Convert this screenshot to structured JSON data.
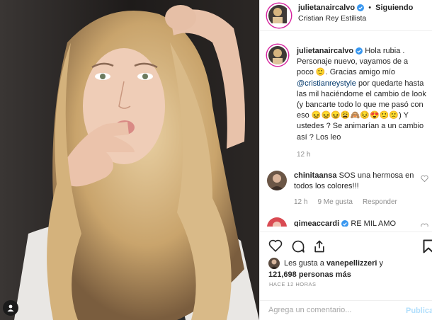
{
  "post_author": {
    "username": "julietanaircalvo",
    "following_label": "Siguiendo",
    "subtitle": "Cristian Rey Estilista"
  },
  "caption": {
    "username": "julietanaircalvo",
    "part1": "Hola rubia . Personaje nuevo, vayamos de a poco",
    "emoji1": "🙂",
    "part2": ". Gracias amigo mío",
    "mention": "@cristianreystyle",
    "part3": "por quedarte hasta las mil haciéndome el cambio de look (y bancarte todo lo que me pasó con eso",
    "emojis": "😖😖😖😩🙈😣😍🙂🙁",
    "part4": ") Y ustedes ? Se animarían a un cambio así ? Los leo",
    "time": "12 h"
  },
  "comments": [
    {
      "username": "chinitaansa",
      "text": "SOS una hermosa en todos los colores!!!",
      "time": "12 h",
      "likes": "9 Me gusta",
      "reply": "Responder"
    },
    {
      "username": "gimeaccardi",
      "text": "RE MIL AMO"
    }
  ],
  "likes": {
    "liked_by_prefix": "Les gusta a",
    "liked_by_user": "vanepellizzeri",
    "liked_by_suffix": "y",
    "count": "121,698",
    "count_suffix": "personas más"
  },
  "time_ago": "HACE 12 HORAS",
  "add_comment": {
    "placeholder": "Agrega un comentario...",
    "publish_label": "Publica"
  },
  "colors": {
    "link": "#00376b",
    "verified": "#3897f0",
    "muted": "#8e8e8e",
    "publish_disabled": "#b2dffc"
  }
}
